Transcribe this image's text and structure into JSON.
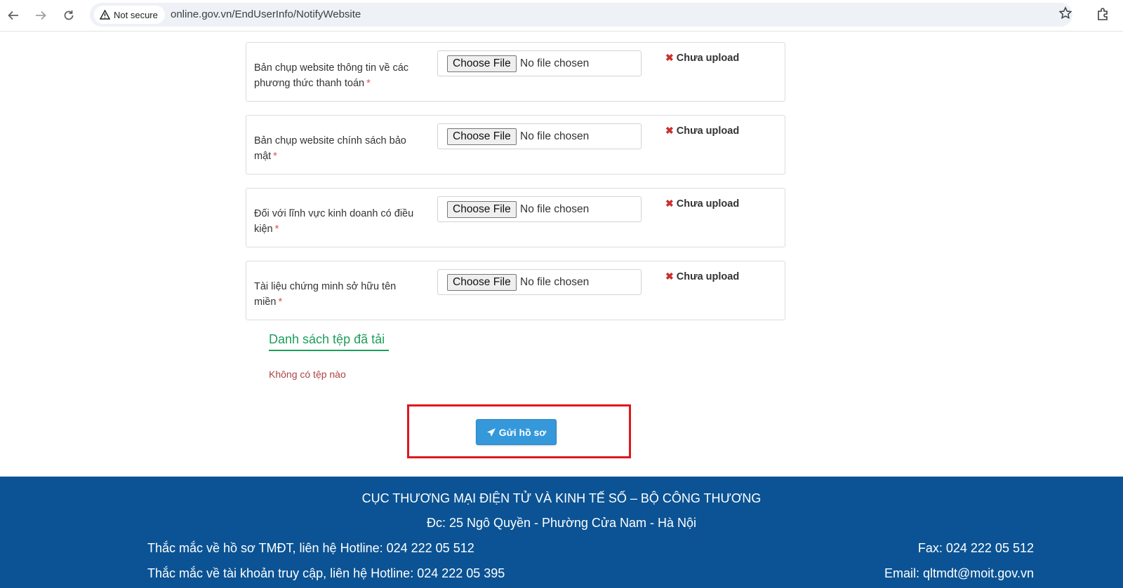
{
  "browser": {
    "security_label": "Not secure",
    "url": "online.gov.vn/EndUserInfo/NotifyWebsite"
  },
  "form": {
    "rows": [
      {
        "label": "Bản chụp website thông tin về các phương thức thanh toán",
        "required_mark": "*",
        "choose_label": "Choose File",
        "file_status": "No file chosen",
        "upload_status": "Chưa upload"
      },
      {
        "label": "Bản chụp website chính sách bảo mật",
        "required_mark": "*",
        "choose_label": "Choose File",
        "file_status": "No file chosen",
        "upload_status": "Chưa upload"
      },
      {
        "label": "Đối với lĩnh vực kinh doanh có điều kiện",
        "required_mark": "*",
        "choose_label": "Choose File",
        "file_status": "No file chosen",
        "upload_status": "Chưa upload"
      },
      {
        "label": "Tài liệu chứng minh sở hữu tên miền",
        "required_mark": "*",
        "choose_label": "Choose File",
        "file_status": "No file chosen",
        "upload_status": "Chưa upload"
      }
    ],
    "uploaded_list_title": "Danh sách tệp đã tải",
    "uploaded_list_empty": "Không có tệp nào",
    "submit_label": "Gửi hồ sơ",
    "highlight_color": "#e0161e",
    "submit_color": "#3498db"
  },
  "footer": {
    "org": "CỤC THƯƠNG MẠI ĐIỆN TỬ VÀ KINH TẾ SỐ – BỘ CÔNG THƯƠNG",
    "address": "Đc: 25 Ngô Quyền - Phường Cửa Nam - Hà Nội",
    "hotline_tmdt": "Thắc mắc về hồ sơ TMĐT, liên hệ Hotline: 024 222 05 512",
    "hotline_account": "Thắc mắc về tài khoản truy cập, liên hệ Hotline: 024 222 05 395",
    "fax": "Fax: 024 222 05 512",
    "email": "Email: qltmdt@moit.gov.vn",
    "background": "#0b5394"
  }
}
